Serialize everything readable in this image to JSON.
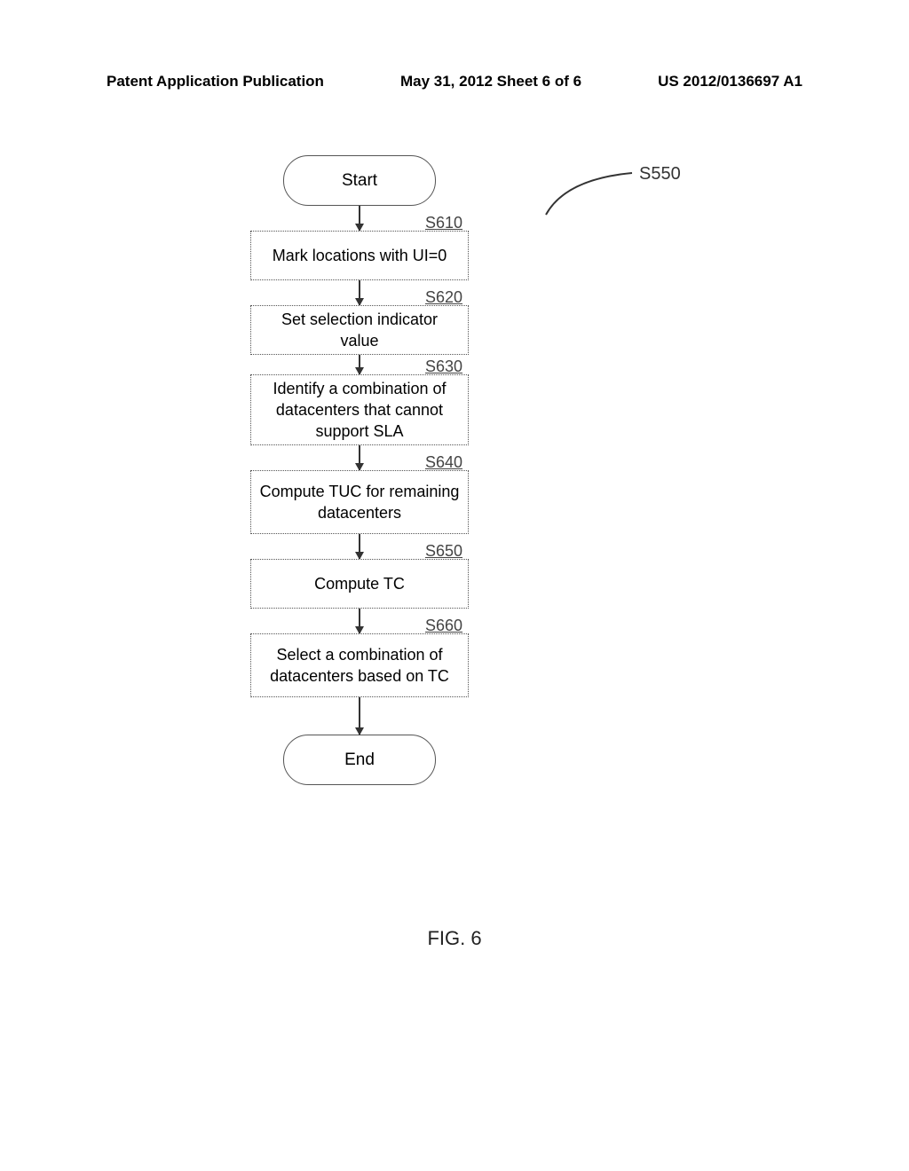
{
  "header": {
    "left": "Patent Application Publication",
    "center": "May 31, 2012  Sheet 6 of 6",
    "right": "US 2012/0136697 A1"
  },
  "reference_label": "S550",
  "flowchart": {
    "start": "Start",
    "end": "End",
    "steps": [
      {
        "id": "S610",
        "text": "Mark locations with UI=0"
      },
      {
        "id": "S620",
        "text": "Set selection indicator value"
      },
      {
        "id": "S630",
        "text": "Identify a combination of datacenters that cannot support SLA"
      },
      {
        "id": "S640",
        "text": "Compute TUC for remaining datacenters"
      },
      {
        "id": "S650",
        "text": "Compute TC"
      },
      {
        "id": "S660",
        "text": "Select a combination of datacenters based on TC"
      }
    ]
  },
  "figure_caption": "FIG. 6",
  "chart_data": {
    "type": "flowchart",
    "title": "FIG. 6",
    "reference": "S550",
    "nodes": [
      {
        "id": "start",
        "shape": "terminal",
        "label": "Start"
      },
      {
        "id": "S610",
        "shape": "process",
        "label": "Mark locations with UI=0"
      },
      {
        "id": "S620",
        "shape": "process",
        "label": "Set selection indicator value"
      },
      {
        "id": "S630",
        "shape": "process",
        "label": "Identify a combination of datacenters that cannot support SLA"
      },
      {
        "id": "S640",
        "shape": "process",
        "label": "Compute TUC for remaining datacenters"
      },
      {
        "id": "S650",
        "shape": "process",
        "label": "Compute TC"
      },
      {
        "id": "S660",
        "shape": "process",
        "label": "Select a combination of datacenters based on TC"
      },
      {
        "id": "end",
        "shape": "terminal",
        "label": "End"
      }
    ],
    "edges": [
      [
        "start",
        "S610"
      ],
      [
        "S610",
        "S620"
      ],
      [
        "S620",
        "S630"
      ],
      [
        "S630",
        "S640"
      ],
      [
        "S640",
        "S650"
      ],
      [
        "S650",
        "S660"
      ],
      [
        "S660",
        "end"
      ]
    ]
  }
}
